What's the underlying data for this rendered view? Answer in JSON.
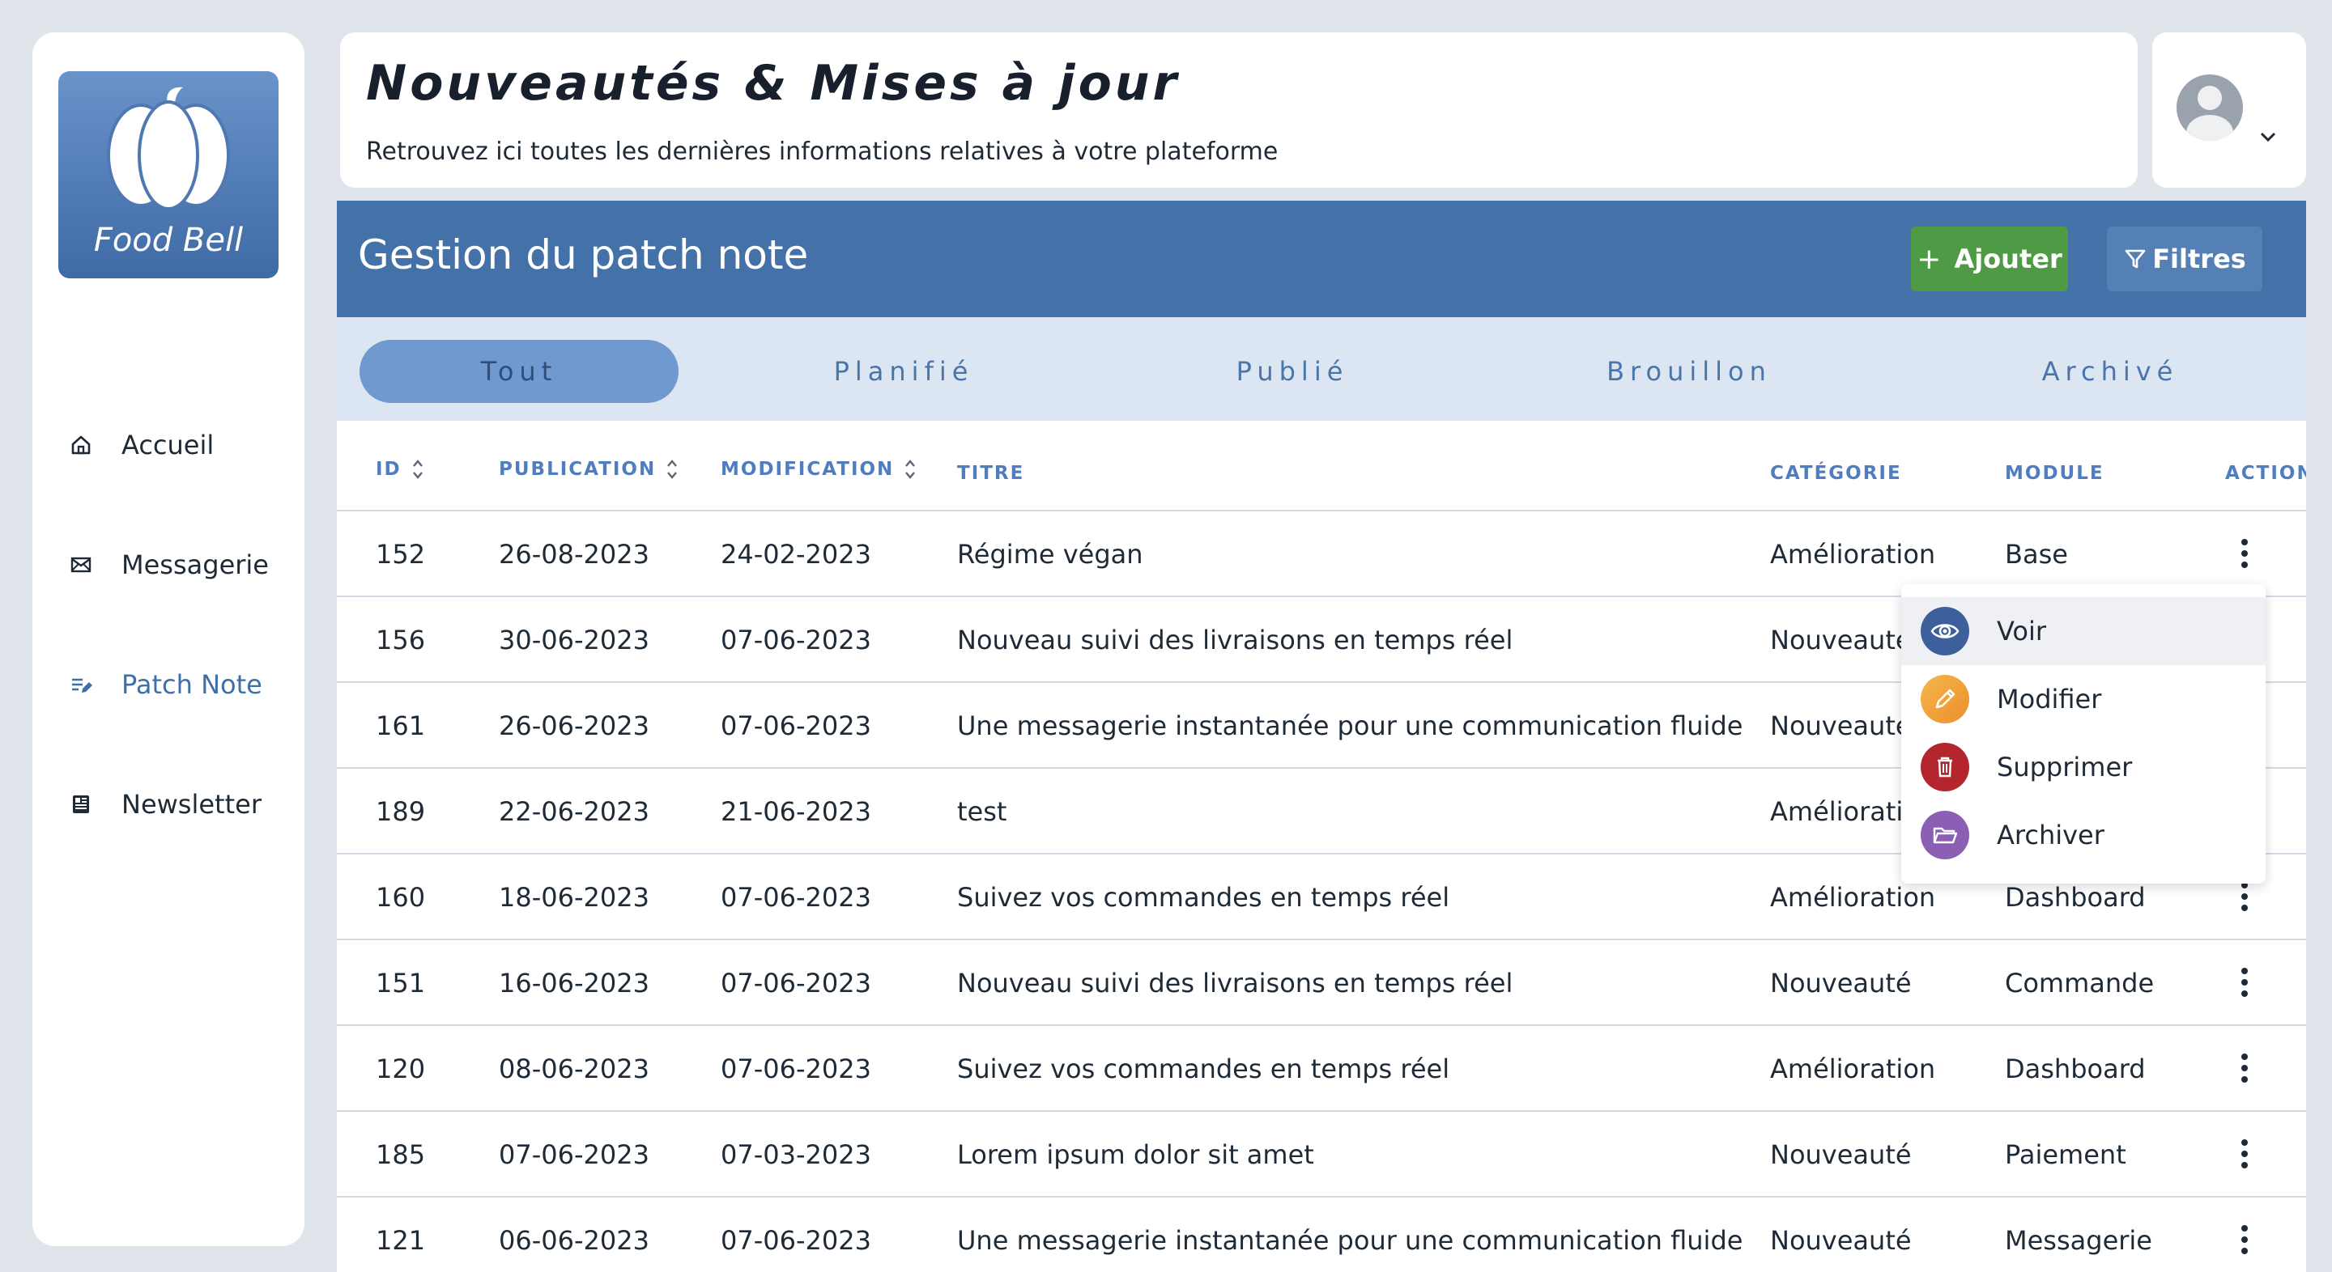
{
  "sidebar": {
    "logo_text": "Food Bell",
    "items": [
      {
        "label": "Accueil",
        "icon": "home-icon",
        "active": false
      },
      {
        "label": "Messagerie",
        "icon": "mail-icon",
        "active": false
      },
      {
        "label": "Patch Note",
        "icon": "edit-list-icon",
        "active": true
      },
      {
        "label": "Newsletter",
        "icon": "newspaper-icon",
        "active": false
      }
    ]
  },
  "header": {
    "title": "Nouveautés & Mises à jour",
    "subtitle": "Retrouvez ici toutes les dernières informations relatives à votre plateforme"
  },
  "panel": {
    "title": "Gestion du patch note",
    "add_label": "Ajouter",
    "filter_label": "Filtres"
  },
  "tabs": [
    {
      "label": "Tout",
      "active": true
    },
    {
      "label": "Planifié",
      "active": false
    },
    {
      "label": "Publié",
      "active": false
    },
    {
      "label": "Brouillon",
      "active": false
    },
    {
      "label": "Archivé",
      "active": false
    }
  ],
  "table": {
    "columns": [
      "ID",
      "PUBLICATION",
      "MODIFICATION",
      "TITRE",
      "CATÉGORIE",
      "MODULE",
      "ACTION"
    ],
    "rows": [
      {
        "id": "152",
        "publication": "26-08-2023",
        "modification": "24-02-2023",
        "titre": "Régime végan",
        "categorie": "Amélioration",
        "module": "Base"
      },
      {
        "id": "156",
        "publication": "30-06-2023",
        "modification": "07-06-2023",
        "titre": "Nouveau suivi des livraisons en temps réel",
        "categorie": "Nouveauté",
        "module": ""
      },
      {
        "id": "161",
        "publication": "26-06-2023",
        "modification": "07-06-2023",
        "titre": "Une messagerie instantanée pour une communication fluide",
        "categorie": "Nouveauté",
        "module": ""
      },
      {
        "id": "189",
        "publication": "22-06-2023",
        "modification": "21-06-2023",
        "titre": "test",
        "categorie": "Amélioration",
        "module": ""
      },
      {
        "id": "160",
        "publication": "18-06-2023",
        "modification": "07-06-2023",
        "titre": "Suivez vos commandes en temps réel",
        "categorie": "Amélioration",
        "module": "Dashboard"
      },
      {
        "id": "151",
        "publication": "16-06-2023",
        "modification": "07-06-2023",
        "titre": "Nouveau suivi des livraisons en temps réel",
        "categorie": "Nouveauté",
        "module": "Commande"
      },
      {
        "id": "120",
        "publication": "08-06-2023",
        "modification": "07-06-2023",
        "titre": "Suivez vos commandes en temps réel",
        "categorie": "Amélioration",
        "module": "Dashboard"
      },
      {
        "id": "185",
        "publication": "07-06-2023",
        "modification": "07-03-2023",
        "titre": "Lorem ipsum dolor sit amet",
        "categorie": "Nouveauté",
        "module": "Paiement"
      },
      {
        "id": "121",
        "publication": "06-06-2023",
        "modification": "07-06-2023",
        "titre": "Une messagerie instantanée pour une communication fluide",
        "categorie": "Nouveauté",
        "module": "Messagerie"
      }
    ]
  },
  "action_menu": {
    "items": [
      {
        "label": "Voir",
        "icon": "eye-icon",
        "color": "#3d5f9c"
      },
      {
        "label": "Modifier",
        "icon": "pencil-icon",
        "color": "#f0a23c"
      },
      {
        "label": "Supprimer",
        "icon": "trash-icon",
        "color": "#b3262e"
      },
      {
        "label": "Archiver",
        "icon": "folder-icon",
        "color": "#8a5fb4"
      }
    ]
  },
  "colors": {
    "primary": "#4571a9",
    "add_button": "#4f9a44",
    "tab_active": "#6f99cf",
    "tab_bar": "#dce5f2"
  }
}
